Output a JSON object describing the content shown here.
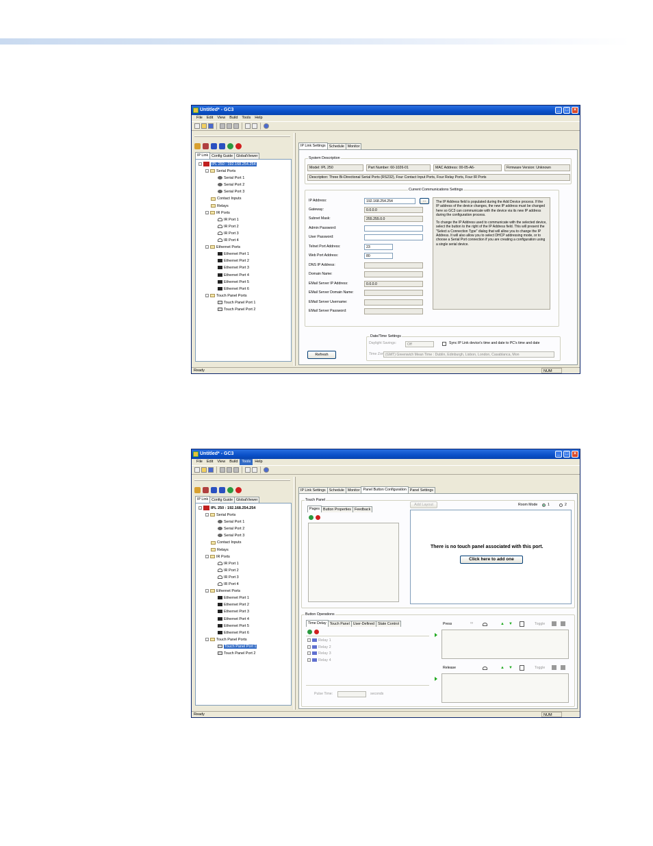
{
  "window": {
    "title": "Untitled* - GC3",
    "menu": [
      "File",
      "Edit",
      "View",
      "Build",
      "Tools",
      "Help"
    ],
    "status_text": "Ready",
    "status_num": "NUM"
  },
  "left_tabs": [
    "IP Link",
    "Config Guide",
    "GlobalViewer"
  ],
  "tree": {
    "root": "IPL 250 : 192.168.254.254",
    "serial_ports": "Serial Ports",
    "serial": [
      "Serial Port 1",
      "Serial Port 2",
      "Serial Port 3"
    ],
    "contact_inputs": "Contact Inputs",
    "relays": "Relays",
    "ir_ports": "IR Ports",
    "ir": [
      "IR Port 1",
      "IR Port 2",
      "IR Port 3",
      "IR Port 4"
    ],
    "ethernet_ports": "Ethernet Ports",
    "eth": [
      "Ethernet Port 1",
      "Ethernet Port 2",
      "Ethernet Port 3",
      "Ethernet Port 4",
      "Ethernet Port 5",
      "Ethernet Port 6"
    ],
    "touch_panel_ports": "Touch Panel Ports",
    "tp": [
      "Touch Panel Port 1",
      "Touch Panel Port 2"
    ]
  },
  "screen1": {
    "tabs": [
      "IP Link Settings",
      "Schedule",
      "Monitor"
    ],
    "system_description_title": "System Description",
    "model": "Model:  IPL 250",
    "part_number": "Part Number:  60-1026-01",
    "mac": "MAC Address: 00-05-A6-",
    "firmware": "Firmware Version: Unknown",
    "description": "Description:  Three Bi-Directional Serial Ports (RS232), Four Contact Input Ports, Four Relay Ports, Four IR Ports",
    "comm_title": "Current Communications Settings",
    "fields": [
      {
        "label": "IP Address:",
        "value": "192.168.254.254"
      },
      {
        "label": "Gateway:",
        "value": "0.0.0.0"
      },
      {
        "label": "Subnet Mask:",
        "value": "255.255.0.0"
      },
      {
        "label": "Admin Password:",
        "value": ""
      },
      {
        "label": "User Password:",
        "value": ""
      },
      {
        "label": "Telnet Port Address:",
        "value": "23"
      },
      {
        "label": "Web Port Address:",
        "value": "80"
      },
      {
        "label": "DNS IP Address:",
        "value": ""
      },
      {
        "label": "Domain Name:",
        "value": ""
      },
      {
        "label": "EMail Server IP Address:",
        "value": "0.0.0.0"
      },
      {
        "label": "EMail Server Domain Name:",
        "value": ""
      },
      {
        "label": "EMail Server Username:",
        "value": ""
      },
      {
        "label": "EMail Server Password:",
        "value": ""
      }
    ],
    "browse": "...",
    "help_p1": "The IP Address field is populated during the Add Device process.  If the IP address of the device changes, the new IP address must be changed here so GC3 can communicate with the device via its new IP address during the configuration process.",
    "help_p2": "To change the IP Address used to communicate with the selected device, select the button to the right of the IP Address field. This will present the \"Select a Connection Type\" dialog that will allow you to change the IP Address. It will also allow you to select DHCP addressing mode, or to choose a Serial Port connection if you are creating a configuration using a single serial device.",
    "datetime_title": "Date/Time Settings",
    "daylight_label": "Daylight Savings:",
    "daylight_value": "Off",
    "sync_label": "Sync IP Link device's time and date to PC's time and date",
    "timezone_label": "Time Zone:",
    "timezone_value": "(GMT) Greenwich Mean Time : Dublin, Edinburgh, Lisbon, London, Casablanca, Mon",
    "refresh": "Refresh"
  },
  "screen2": {
    "tabs": [
      "IP Link Settings",
      "Schedule",
      "Monitor",
      "Panel Button Configuration",
      "Panel Settings"
    ],
    "touch_panel_title": "Touch Panel",
    "sub_tabs": [
      "Pages",
      "Button Properties",
      "Feedback"
    ],
    "add_layout": "Add Layout",
    "room_mode_label": "Room Mode",
    "room_mode_1": "1",
    "room_mode_2": "2",
    "no_panel_msg": "There is no touch panel associated with this port.",
    "add_one": "Click here to add one",
    "button_ops_title": "Button Operations",
    "op_tabs": [
      "Time Delay",
      "Touch Panel",
      "User-Defined",
      "State Control"
    ],
    "relays": [
      "Relay 1",
      "Relay 2",
      "Relay 3",
      "Relay 4"
    ],
    "pulse_label": "Pulse Time:",
    "seconds": "seconds",
    "press": "Press",
    "release": "Release",
    "infinity": "∞",
    "toggle": "Toggle"
  }
}
